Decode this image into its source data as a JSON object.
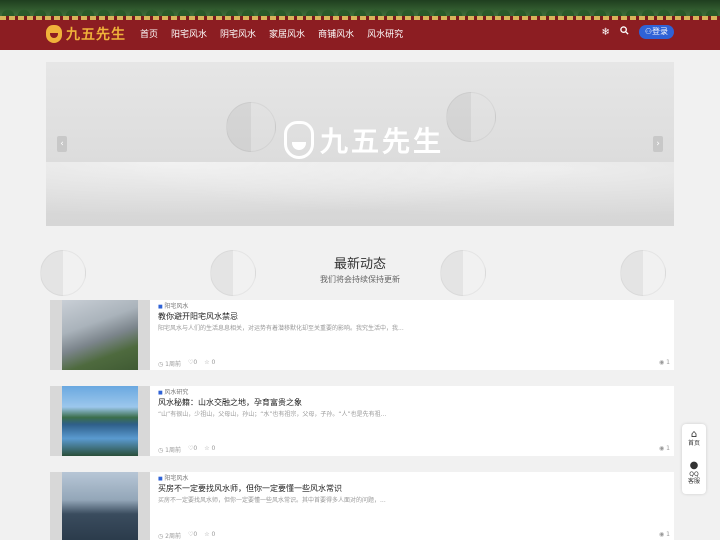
{
  "header": {
    "logo_text": "九五先生",
    "menu": [
      "首页",
      "阳宅风水",
      "阴宅风水",
      "家居风水",
      "商铺风水",
      "风水研究"
    ],
    "login_label": "登录"
  },
  "banner": {
    "logo_text": "九五先生"
  },
  "section": {
    "title": "最新动态",
    "subtitle": "我们将会持续保持更新"
  },
  "articles": [
    {
      "category": "阳宅风水",
      "title": "教你避开阳宅风水禁忌",
      "excerpt": "阳宅风水与人们的生活息息相关，对运势有着潜移默化却至关重要的影响。我究生活中，我...",
      "time": "1周前",
      "likes": "0",
      "favorites": "0",
      "views": "1"
    },
    {
      "category": "风水研究",
      "title": "风水秘籍：山水交融之地，孕育富贵之象",
      "excerpt": "“山”有很山，少祖山，父母山，孙山；“水”也有祖宗，父母，子孙。“人”也是先有祖...",
      "time": "1周前",
      "likes": "0",
      "favorites": "0",
      "views": "1"
    },
    {
      "category": "阳宅风水",
      "title": "买房不一定要找风水师，但你一定要懂一些风水常识",
      "excerpt": "买房不一定要找风水师，但你一定要懂一些风水常识。其中首要得多人面对的问题，...",
      "time": "2周前",
      "likes": "0",
      "favorites": "0",
      "views": "1"
    }
  ],
  "float": {
    "home_label": "首页",
    "qq_label_1": "QQ",
    "qq_label_2": "客服"
  },
  "icons": {
    "theme": "gear-icon",
    "search": "search-icon",
    "user": "user-icon",
    "clock": "clock-icon",
    "heart": "heart-icon",
    "star": "star-icon",
    "eye": "eye-icon"
  },
  "colors": {
    "header_bg": "#8c1d22",
    "logo": "#f0b23a",
    "login_button": "#2f62d6"
  }
}
